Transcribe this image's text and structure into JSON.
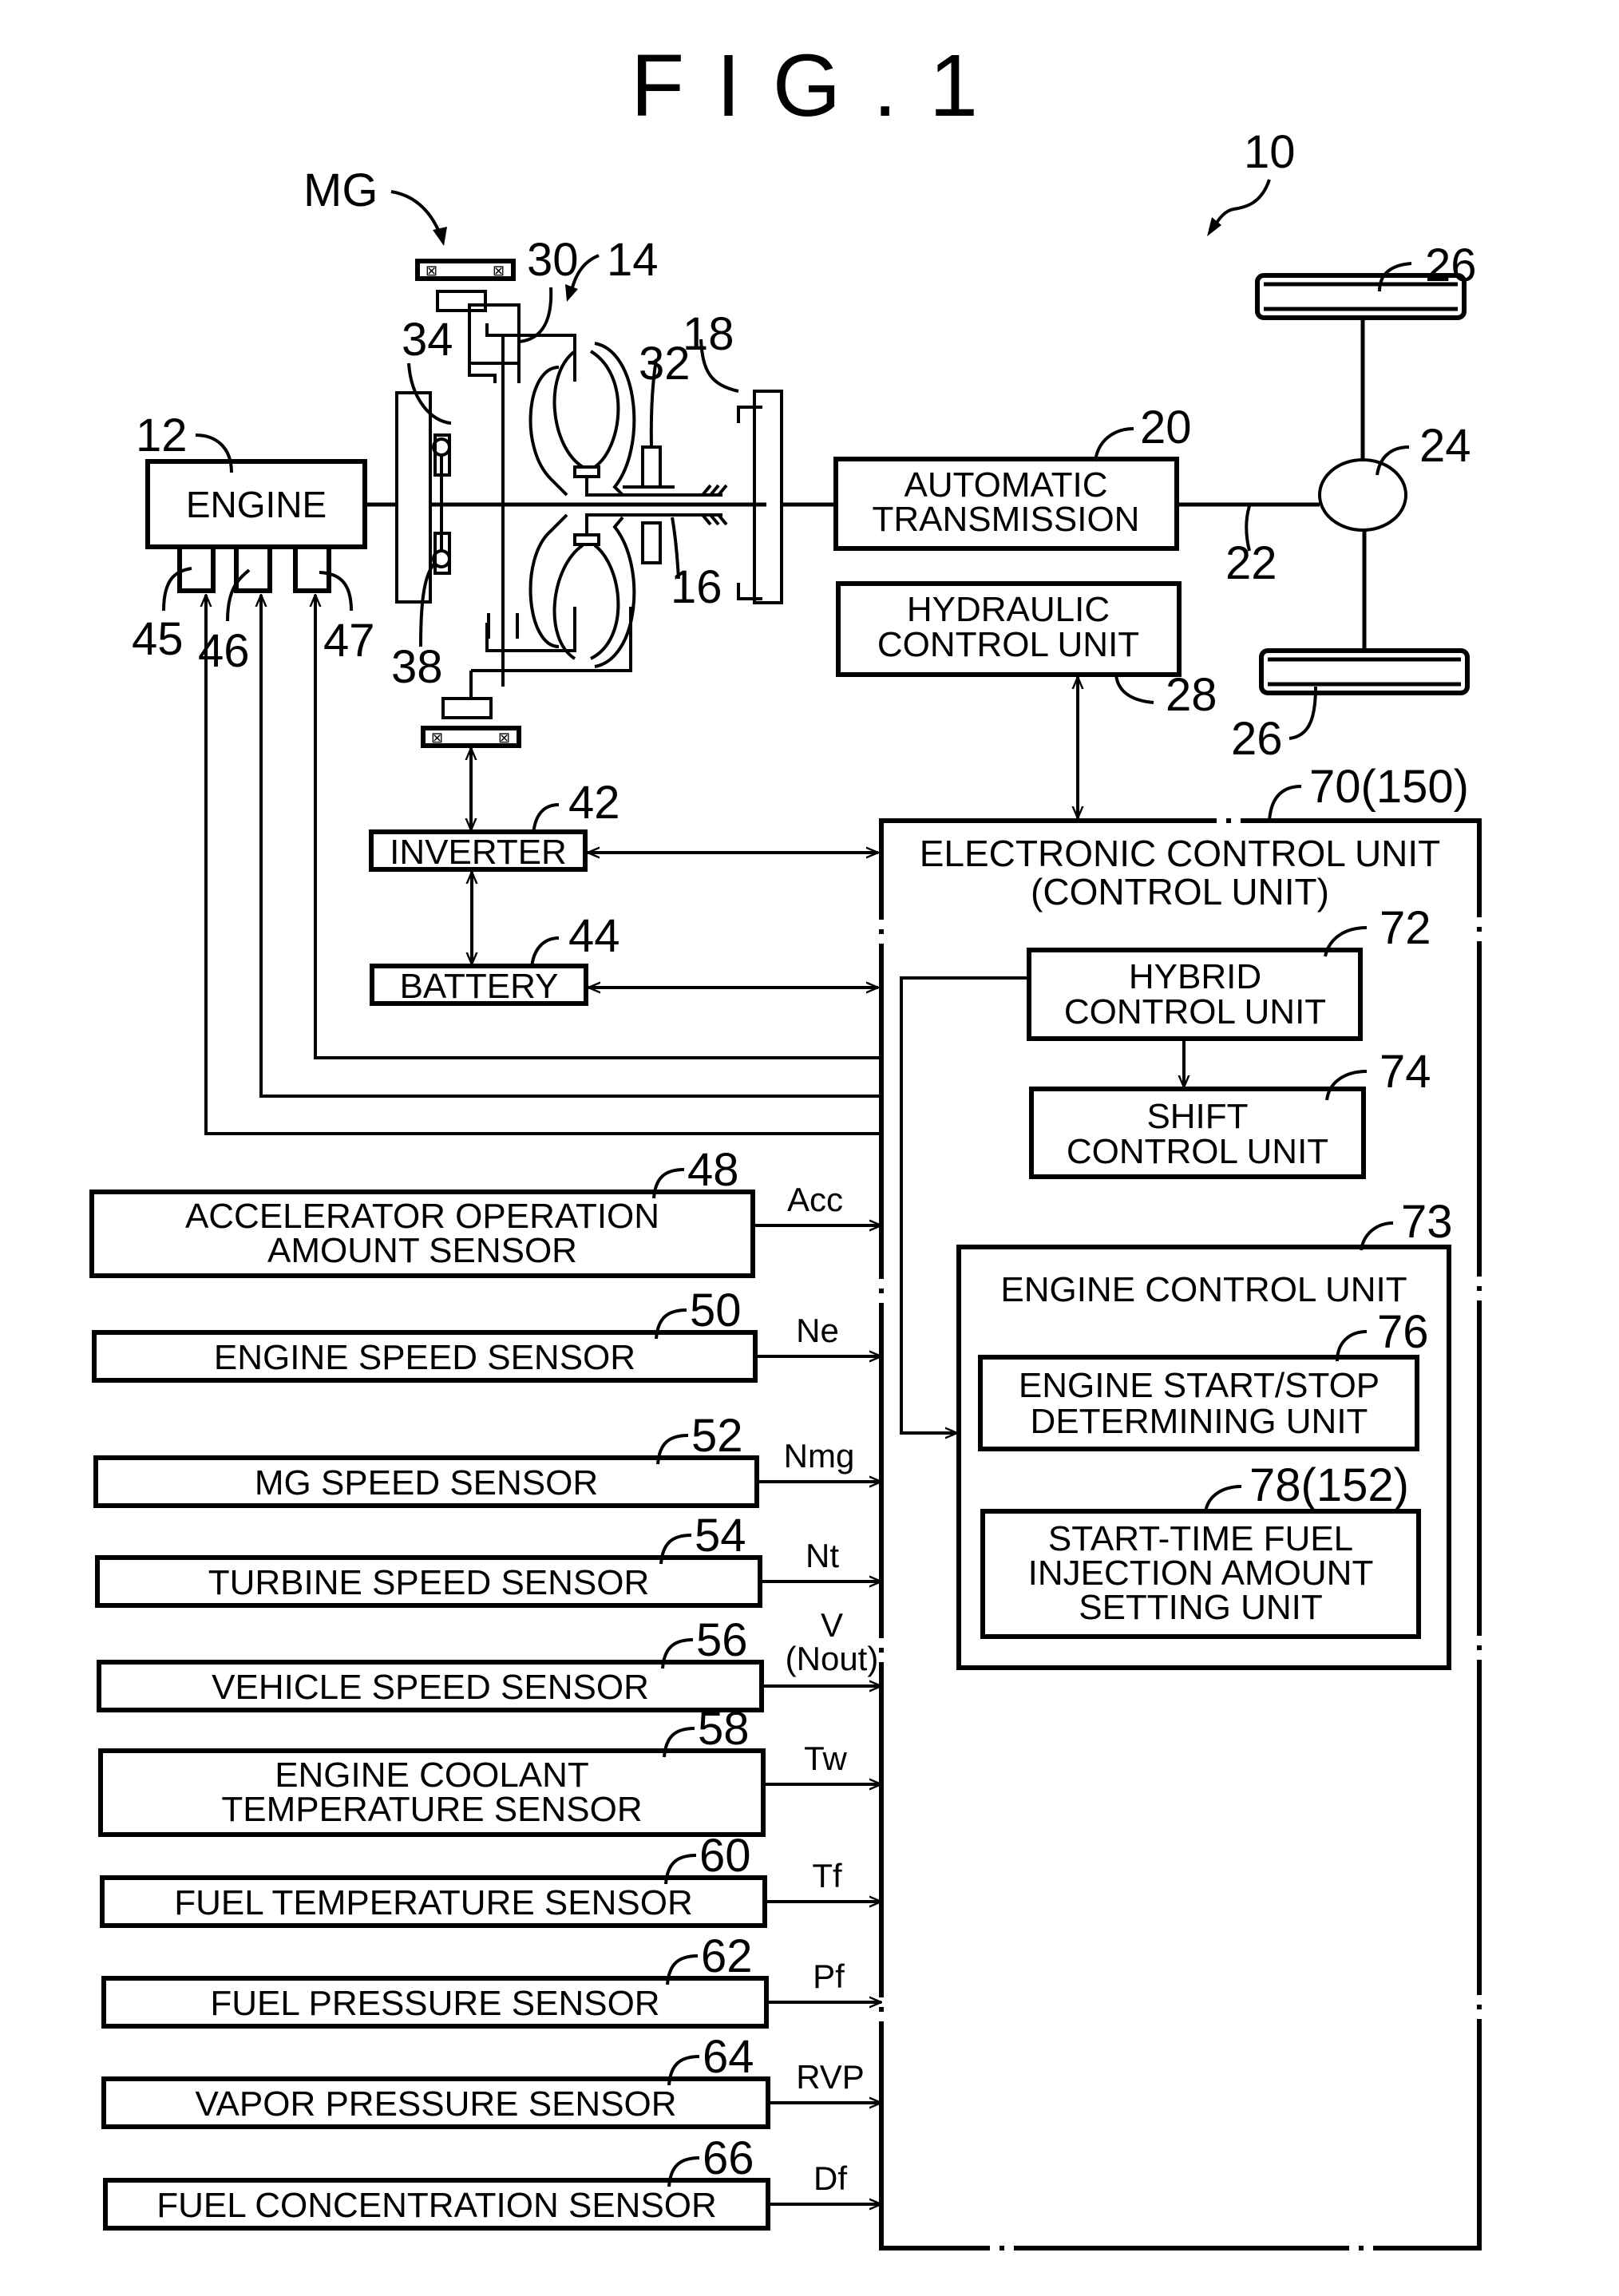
{
  "figure": {
    "title": "FIG.1",
    "system_ref": "10"
  },
  "powertrain": {
    "engine": {
      "label": "ENGINE",
      "ref": "12"
    },
    "mg": {
      "label": "MG"
    },
    "torque_converter_ref": "14",
    "refs": {
      "r16": "16",
      "r18": "18",
      "r30": "30",
      "r32": "32",
      "r34": "34",
      "r38": "38",
      "r22": "22",
      "r24": "24",
      "r26a": "26",
      "r26b": "26"
    },
    "engine_sensors": [
      {
        "ref": "45"
      },
      {
        "ref": "46"
      },
      {
        "ref": "47"
      }
    ],
    "automatic_transmission": {
      "line1": "AUTOMATIC",
      "line2": "TRANSMISSION",
      "ref": "20"
    },
    "hydraulic_control": {
      "line1": "HYDRAULIC",
      "line2": "CONTROL UNIT",
      "ref": "28"
    },
    "inverter": {
      "label": "INVERTER",
      "ref": "42"
    },
    "battery": {
      "label": "BATTERY",
      "ref": "44"
    }
  },
  "ecu": {
    "line1": "ELECTRONIC CONTROL UNIT",
    "line2": "(CONTROL UNIT)",
    "ref": "70(150)",
    "hybrid": {
      "line1": "HYBRID",
      "line2": "CONTROL UNIT",
      "ref": "72"
    },
    "shift": {
      "line1": "SHIFT",
      "line2": "CONTROL UNIT",
      "ref": "74"
    },
    "engine_control": {
      "label": "ENGINE CONTROL UNIT",
      "ref": "73"
    },
    "start_stop": {
      "line1": "ENGINE START/STOP",
      "line2": "DETERMINING UNIT",
      "ref": "76"
    },
    "fuel_injection": {
      "line1": "START-TIME FUEL",
      "line2": "INJECTION AMOUNT",
      "line3": "SETTING UNIT",
      "ref": "78(152)"
    }
  },
  "sensors": [
    {
      "line1": "ACCELERATOR OPERATION",
      "line2": "AMOUNT SENSOR",
      "ref": "48",
      "signal": "Acc"
    },
    {
      "line1": "ENGINE SPEED SENSOR",
      "ref": "50",
      "signal": "Ne"
    },
    {
      "line1": "MG SPEED SENSOR",
      "ref": "52",
      "signal": "Nmg"
    },
    {
      "line1": "TURBINE SPEED SENSOR",
      "ref": "54",
      "signal": "Nt"
    },
    {
      "line1": "VEHICLE SPEED SENSOR",
      "ref": "56",
      "signal": "V",
      "signal2": "(Nout)"
    },
    {
      "line1": "ENGINE COOLANT",
      "line2": "TEMPERATURE SENSOR",
      "ref": "58",
      "signal": "Tw"
    },
    {
      "line1": "FUEL TEMPERATURE SENSOR",
      "ref": "60",
      "signal": "Tf"
    },
    {
      "line1": "FUEL PRESSURE SENSOR",
      "ref": "62",
      "signal": "Pf"
    },
    {
      "line1": "VAPOR PRESSURE SENSOR",
      "ref": "64",
      "signal": "RVP"
    },
    {
      "line1": "FUEL CONCENTRATION SENSOR",
      "ref": "66",
      "signal": "Df"
    }
  ]
}
